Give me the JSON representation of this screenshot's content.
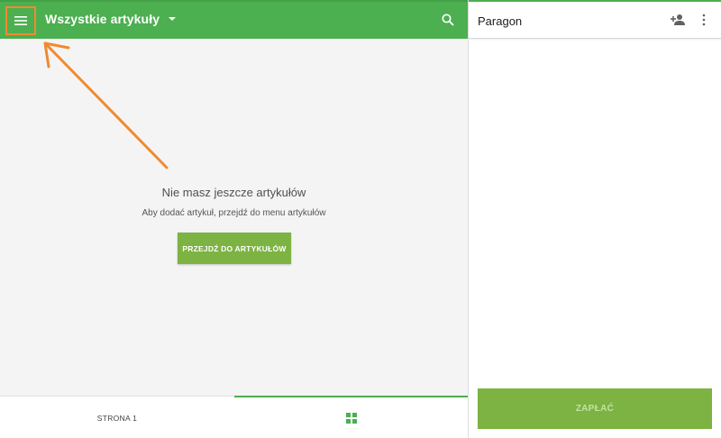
{
  "header": {
    "menu_icon": "hamburger-menu-icon",
    "title": "Wszystkie artykuły",
    "dropdown_icon": "caret-down-icon",
    "search_icon": "search-icon"
  },
  "empty_state": {
    "title": "Nie masz jeszcze artykułów",
    "subtitle": "Aby dodać artykuł, przejdź do menu artykułów",
    "button_label": "PRZEJDŹ DO ARTYKUŁÓW"
  },
  "bottom_tabs": {
    "page_label": "STRONA 1",
    "grid_icon": "grid-icon"
  },
  "receipt": {
    "title": "Paragon",
    "add_customer_icon": "add-person-icon",
    "more_icon": "more-vertical-icon",
    "pay_label": "ZAPŁAĆ"
  },
  "colors": {
    "primary": "#4caf50",
    "button": "#7cb342",
    "highlight": "#f08a30"
  }
}
